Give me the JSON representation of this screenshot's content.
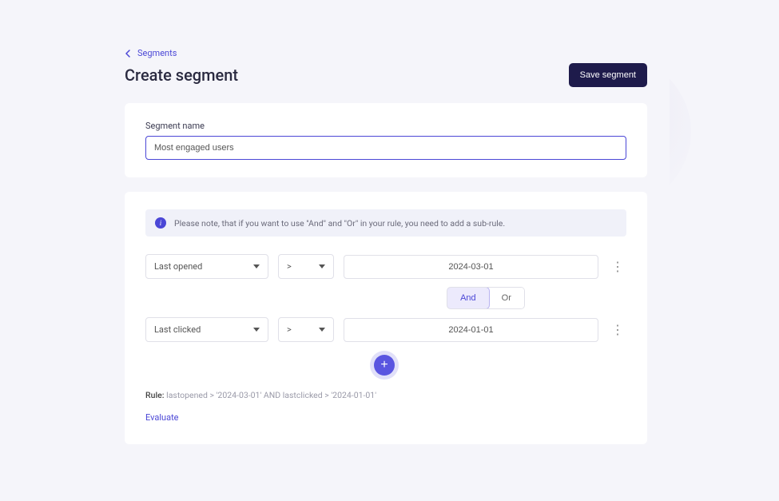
{
  "breadcrumb": {
    "label": "Segments"
  },
  "header": {
    "title": "Create segment",
    "save_label": "Save segment"
  },
  "segment_name": {
    "label": "Segment name",
    "value": "Most engaged users"
  },
  "info": {
    "text": "Please note, that if you want to use \"And\" and \"Or\" in your rule, you need to add a sub-rule."
  },
  "rules": [
    {
      "field": "Last opened",
      "operator": ">",
      "value": "2024-03-01"
    },
    {
      "field": "Last clicked",
      "operator": ">",
      "value": "2024-01-01"
    }
  ],
  "connector": {
    "and": "And",
    "or": "Or",
    "active": "and"
  },
  "summary": {
    "label": "Rule:",
    "text": "lastopened > '2024-03-01' AND lastclicked > '2024-01-01'"
  },
  "evaluate_label": "Evaluate"
}
